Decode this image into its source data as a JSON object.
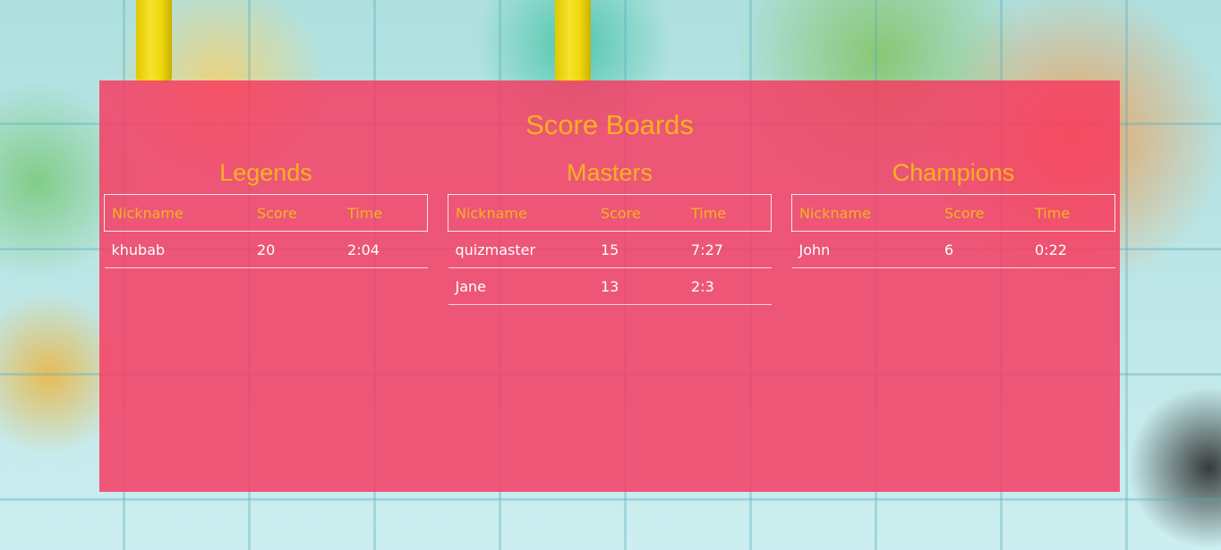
{
  "title": "Score Boards",
  "boards": [
    {
      "name": "Legends",
      "columns": [
        "Nickname",
        "Score",
        "Time"
      ],
      "rows": [
        [
          "khubab",
          "20",
          "2:04"
        ]
      ]
    },
    {
      "name": "Masters",
      "columns": [
        "Nickname",
        "Score",
        "Time"
      ],
      "rows": [
        [
          "quizmaster",
          "15",
          "7:27"
        ],
        [
          "Jane",
          "13",
          "2:3"
        ]
      ]
    },
    {
      "name": "Champions",
      "columns": [
        "Nickname",
        "Score",
        "Time"
      ],
      "rows": [
        [
          "John",
          "6",
          "0:22"
        ]
      ]
    }
  ],
  "colors": {
    "panel": "#f73a62",
    "accent": "#f7b21e",
    "text": "#ffffff"
  },
  "background": {
    "description_icon": "world-map-background",
    "pins": [
      "yellow-pin",
      "yellow-pin"
    ]
  }
}
